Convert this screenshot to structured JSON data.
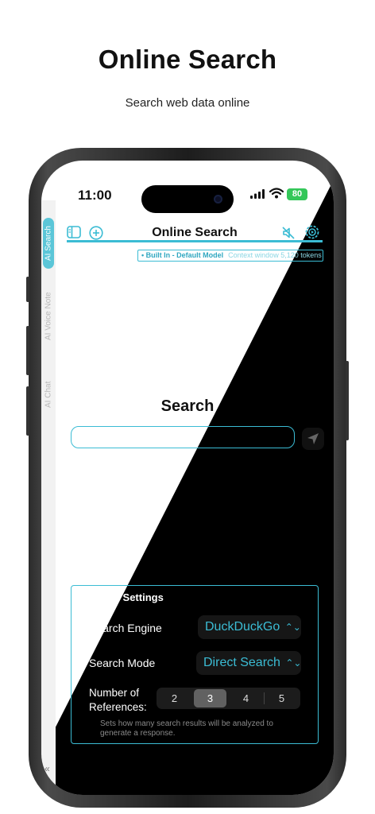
{
  "hero": {
    "title": "Online Search",
    "subtitle": "Search web data online"
  },
  "status_bar": {
    "time": "11:00",
    "battery": "80"
  },
  "sidebar": {
    "tabs": [
      {
        "label": "AI Search",
        "active": true
      },
      {
        "label": "AI Voice Note",
        "active": false
      },
      {
        "label": "AI Chat",
        "active": false
      }
    ]
  },
  "header": {
    "title": "Online Search"
  },
  "model": {
    "name": "• Built In - Default Model",
    "context": "Context window 5,120 tokens"
  },
  "search": {
    "label": "Search",
    "value": ""
  },
  "settings": {
    "title": "Search Settings",
    "engine_label": "Search Engine",
    "engine_value": "DuckDuckGo",
    "mode_label": "Search Mode",
    "mode_value": "Direct Search",
    "refs_label": "Number of\nReferences:",
    "refs_options": [
      "2",
      "3",
      "4",
      "5"
    ],
    "refs_selected": "3",
    "refs_help": "Sets how many search results will be analyzed to generate a response."
  },
  "colors": {
    "accent": "#3bbcd4",
    "battery": "#34c759",
    "tab_active": "#5bc6d8"
  }
}
